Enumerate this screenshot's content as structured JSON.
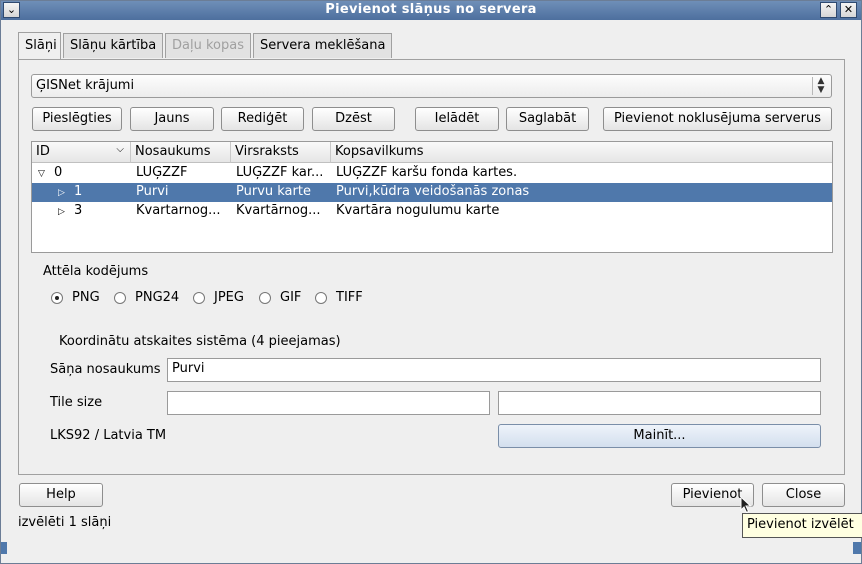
{
  "window": {
    "title": "Pievienot slāņus no servera",
    "menu_btn": "⌄",
    "collapse_btn": "⌃",
    "close_btn": "✕"
  },
  "tabs": [
    {
      "label": "Slāņi"
    },
    {
      "label": "Slāņu kārtība"
    },
    {
      "label": "Daļu kopas"
    },
    {
      "label": "Servera meklēšana"
    }
  ],
  "connection": {
    "selected": "ĢISNet krājumi"
  },
  "toolbar": {
    "connect": "Pieslēgties",
    "new": "Jauns",
    "edit": "Rediģēt",
    "delete": "Dzēst",
    "load": "Ielādēt",
    "save": "Saglabāt",
    "add_default": "Pievienot noklusējuma serverus"
  },
  "layers": {
    "headers": [
      "ID",
      "Nosaukums",
      "Virsraksts",
      "Kopsavilkums"
    ],
    "rows": [
      {
        "id": "0",
        "name": "LUĢZZF",
        "title": "LUĢZZF kar...",
        "abstract": "LUĢZZF karšu fonda kartes.",
        "expander": "▽"
      },
      {
        "id": "1",
        "name": "Purvi",
        "title": "Purvu karte",
        "abstract": "Purvi,kūdra veidošanās zonas",
        "expander": "▷"
      },
      {
        "id": "3",
        "name": "Kvartarnog...",
        "title": "Kvartārnog...",
        "abstract": "Kvartāra nogulumu karte",
        "expander": "▷"
      }
    ]
  },
  "encoding": {
    "label": "Attēla kodējums",
    "options": [
      "PNG",
      "PNG24",
      "JPEG",
      "GIF",
      "TIFF"
    ],
    "selected": "PNG"
  },
  "crs": {
    "group_label": "Koordinātu atskaites sistēma (4 pieejamas)",
    "layer_name_label": "Sāņa nosaukums",
    "layer_name_value": "Purvi",
    "tile_size_label": "Tile size",
    "tile_width": "",
    "tile_height": "",
    "current": "LKS92 / Latvia TM",
    "change_button": "Mainīt..."
  },
  "footer": {
    "help": "Help",
    "add": "Pievienot",
    "close": "Close",
    "status": "izvēlēti 1 slāņi",
    "tooltip": "Pievienot izvēlēt"
  },
  "colors": {
    "titlebar": "#5a7aa8",
    "selection": "#4f78ab"
  }
}
